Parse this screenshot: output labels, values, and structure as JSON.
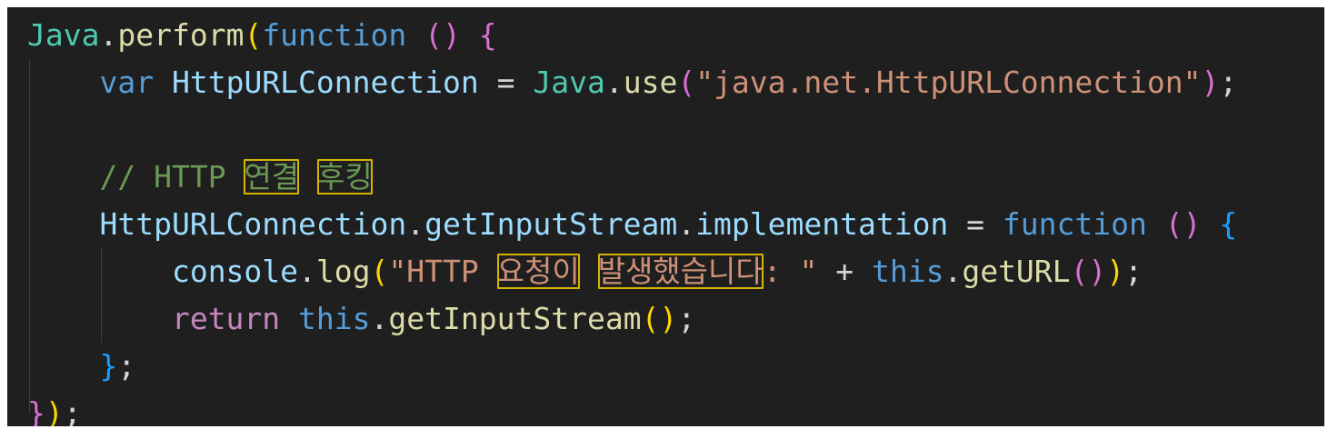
{
  "editor": {
    "lines": [
      {
        "tokens": [
          {
            "t": "Java",
            "c": "cls"
          },
          {
            "t": ".",
            "c": "plain"
          },
          {
            "t": "perform",
            "c": "fn"
          },
          {
            "t": "(",
            "c": "p1"
          },
          {
            "t": "function",
            "c": "kw"
          },
          {
            "t": " ",
            "c": "plain"
          },
          {
            "t": "()",
            "c": "p2"
          },
          {
            "t": " ",
            "c": "plain"
          },
          {
            "t": "{",
            "c": "p2"
          }
        ]
      },
      {
        "indent": "    ",
        "tokens": [
          {
            "t": "var",
            "c": "kw"
          },
          {
            "t": " ",
            "c": "plain"
          },
          {
            "t": "HttpURLConnection",
            "c": "id"
          },
          {
            "t": " = ",
            "c": "plain"
          },
          {
            "t": "Java",
            "c": "cls"
          },
          {
            "t": ".",
            "c": "plain"
          },
          {
            "t": "use",
            "c": "fn"
          },
          {
            "t": "(",
            "c": "p2"
          },
          {
            "t": "\"java.net.HttpURLConnection\"",
            "c": "str"
          },
          {
            "t": ")",
            "c": "p2"
          },
          {
            "t": ";",
            "c": "plain"
          }
        ]
      },
      {
        "indent": "",
        "tokens": []
      },
      {
        "indent": "    ",
        "tokens": [
          {
            "t": "// HTTP ",
            "c": "com"
          },
          {
            "t": "연결",
            "c": "com",
            "hl": true
          },
          {
            "t": " ",
            "c": "com"
          },
          {
            "t": "후킹",
            "c": "com",
            "hl": true
          }
        ]
      },
      {
        "indent": "    ",
        "tokens": [
          {
            "t": "HttpURLConnection",
            "c": "id"
          },
          {
            "t": ".",
            "c": "plain"
          },
          {
            "t": "getInputStream",
            "c": "id"
          },
          {
            "t": ".",
            "c": "plain"
          },
          {
            "t": "implementation",
            "c": "id"
          },
          {
            "t": " = ",
            "c": "plain"
          },
          {
            "t": "function",
            "c": "kw"
          },
          {
            "t": " ",
            "c": "plain"
          },
          {
            "t": "()",
            "c": "p2"
          },
          {
            "t": " ",
            "c": "plain"
          },
          {
            "t": "{",
            "c": "p3"
          }
        ]
      },
      {
        "indent": "        ",
        "tokens": [
          {
            "t": "console",
            "c": "id"
          },
          {
            "t": ".",
            "c": "plain"
          },
          {
            "t": "log",
            "c": "fn"
          },
          {
            "t": "(",
            "c": "p1"
          },
          {
            "t": "\"HTTP ",
            "c": "str"
          },
          {
            "t": "요청이",
            "c": "str",
            "hl": true
          },
          {
            "t": " ",
            "c": "str"
          },
          {
            "t": "발생했습니다",
            "c": "str",
            "hl": true
          },
          {
            "t": ": \"",
            "c": "str"
          },
          {
            "t": " + ",
            "c": "plain"
          },
          {
            "t": "this",
            "c": "kw"
          },
          {
            "t": ".",
            "c": "plain"
          },
          {
            "t": "getURL",
            "c": "fn"
          },
          {
            "t": "()",
            "c": "p2"
          },
          {
            "t": ")",
            "c": "p1"
          },
          {
            "t": ";",
            "c": "plain"
          }
        ]
      },
      {
        "indent": "        ",
        "tokens": [
          {
            "t": "return",
            "c": "kw2"
          },
          {
            "t": " ",
            "c": "plain"
          },
          {
            "t": "this",
            "c": "kw"
          },
          {
            "t": ".",
            "c": "plain"
          },
          {
            "t": "getInputStream",
            "c": "fn"
          },
          {
            "t": "()",
            "c": "p1"
          },
          {
            "t": ";",
            "c": "plain"
          }
        ]
      },
      {
        "indent": "    ",
        "tokens": [
          {
            "t": "}",
            "c": "p3"
          },
          {
            "t": ";",
            "c": "plain"
          }
        ]
      },
      {
        "indent": "",
        "tokens": [
          {
            "t": "}",
            "c": "p2"
          },
          {
            "t": ")",
            "c": "p1"
          },
          {
            "t": ";",
            "c": "plain"
          }
        ]
      }
    ]
  },
  "colors": {
    "background": "#1f1f1f",
    "highlight_box": "#d7b400"
  }
}
